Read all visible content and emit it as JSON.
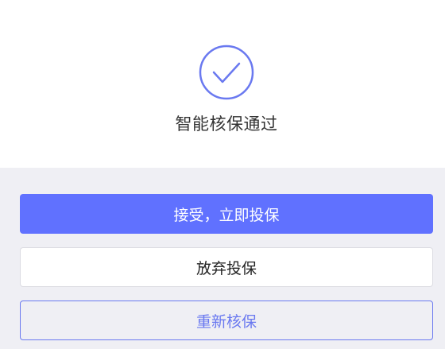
{
  "result": {
    "icon": "check-circle-icon",
    "title": "智能核保通过"
  },
  "actions": {
    "accept_label": "接受，立即投保",
    "abandon_label": "放弃投保",
    "recheck_label": "重新核保"
  },
  "colors": {
    "primary": "#6071ff",
    "icon_stroke": "#6a79f0",
    "page_background": "#efeff4"
  }
}
